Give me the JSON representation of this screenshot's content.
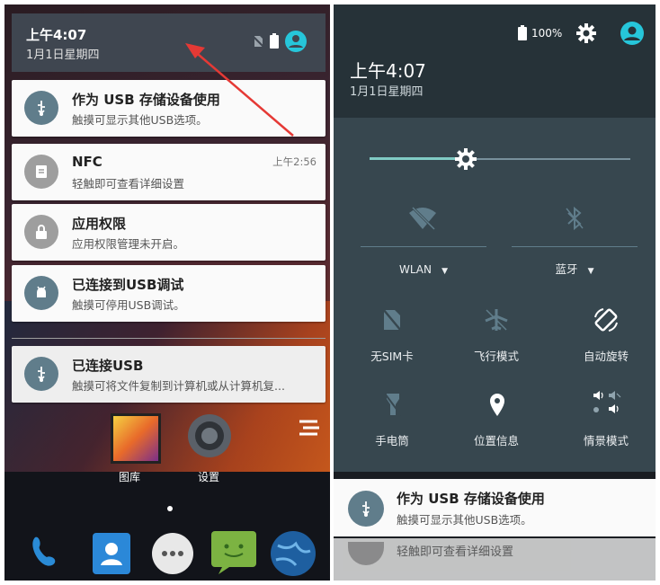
{
  "left": {
    "status": {
      "time": "上午4:07",
      "date": "1月1日星期四"
    },
    "notifications": [
      {
        "title": "作为 USB 存储设备使用",
        "subtitle": "触摸可显示其他USB选项。",
        "time": "",
        "icon": "usb-icon"
      },
      {
        "title": "NFC",
        "subtitle": "轻触即可查看详细设置",
        "time": "上午2:56",
        "icon": "nfc-icon"
      },
      {
        "title": "应用权限",
        "subtitle": "应用权限管理未开启。",
        "time": "",
        "icon": "lock-icon"
      },
      {
        "title": "已连接到USB调试",
        "subtitle": "触摸可停用USB调试。",
        "time": "",
        "icon": "android-icon"
      },
      {
        "title": "已连接USB",
        "subtitle": "触摸可将文件复制到计算机或从计算机复...",
        "time": "",
        "icon": "usb-icon"
      }
    ],
    "home_apps": [
      {
        "label": "图库",
        "icon": "gallery-icon"
      },
      {
        "label": "设置",
        "icon": "settings-gear-icon"
      }
    ],
    "dock": [
      "phone-icon",
      "contacts-icon",
      "app-drawer-icon",
      "messaging-icon",
      "browser-icon"
    ],
    "arrow_color": "#e53935"
  },
  "right": {
    "status": {
      "battery": "100%",
      "time": "上午4:07",
      "date": "1月1日星期四"
    },
    "brightness": {
      "level": 0.37
    },
    "quick_settings": {
      "wifi": {
        "label": "WLAN",
        "icon": "wifi-off-icon"
      },
      "bluetooth": {
        "label": "蓝牙",
        "icon": "bluetooth-off-icon"
      },
      "tiles": [
        {
          "label": "无SIM卡",
          "icon": "no-sim-icon"
        },
        {
          "label": "飞行模式",
          "icon": "airplane-icon"
        },
        {
          "label": "自动旋转",
          "icon": "auto-rotate-icon"
        },
        {
          "label": "手电筒",
          "icon": "flashlight-icon"
        },
        {
          "label": "位置信息",
          "icon": "location-icon"
        },
        {
          "label": "情景模式",
          "icon": "sound-profile-icon"
        }
      ]
    },
    "notification": {
      "title": "作为 USB 存储设备使用",
      "subtitle": "触摸可显示其他USB选项。"
    },
    "peek_text": "轻触即可查看详细设置"
  },
  "colors": {
    "accent": "#80cbc4",
    "avatar": "#26c6da",
    "panel": "#37474f",
    "card": "#fafafa"
  }
}
